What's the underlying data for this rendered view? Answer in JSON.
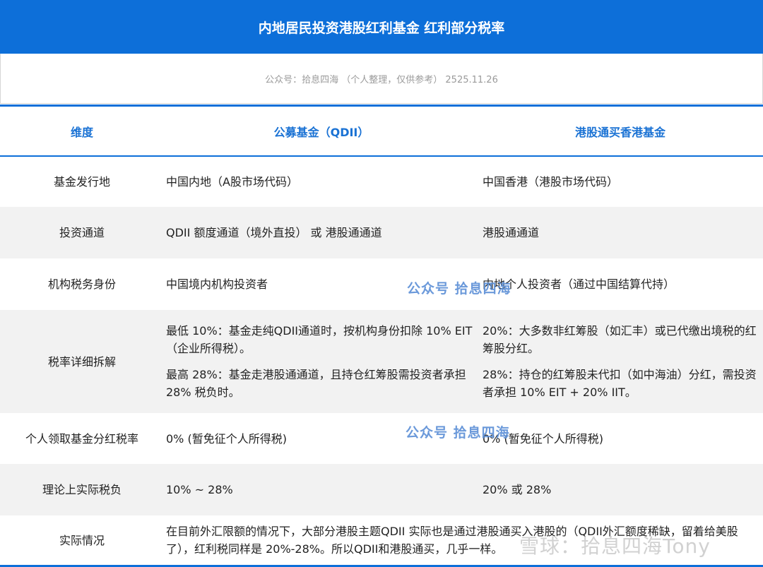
{
  "title": "内地居民投资港股红利基金 红利部分税率",
  "subtitle": "公众号：拾息四海 （个人整理，仅供参考） 2525.11.26",
  "headers": [
    "维度",
    "公募基金（QDII）",
    "港股通买香港基金"
  ],
  "rows": [
    {
      "dim": "基金发行地",
      "qdii": "中国内地（A股市场代码）",
      "hk": "中国香港（港股市场代码）"
    },
    {
      "dim": "投资通道",
      "qdii": "QDII 额度通道（境外直投） 或 港股通通道",
      "hk": "港股通通道"
    },
    {
      "dim": "机构税务身份",
      "qdii": "中国境内机构投资者",
      "hk": "内地个人投资者（通过中国结算代持）"
    },
    {
      "dim": "税率详细拆解",
      "qdii": [
        "最低 10%：基金走纯QDII通道时，按机构身份扣除 10% EIT（企业所得税）。",
        "最高 28%：基金走港股通通道，且持仓红筹股需投资者承担 28% 税负时。"
      ],
      "hk": [
        "20%：大多数非红筹股（如汇丰）或已代缴出境税的红筹股分红。",
        "28%：持仓的红筹股未代扣（如中海油）分红，需投资者承担 10% EIT + 20% IIT。"
      ]
    },
    {
      "dim": "个人领取基金分红税率",
      "qdii": "0% (暂免征个人所得税)",
      "hk": "0% (暂免征个人所得税)"
    },
    {
      "dim": "理论上实际税负",
      "qdii": "10% ~ 28%",
      "hk": "20% 或 28%"
    },
    {
      "dim": "实际情况",
      "wide": "在目前外汇限额的情况下，大部分港股主题QDII 实际也是通过港股通买入港股的（QDII外汇额度稀缺，留着给美股了），红利税同样是 20%-28%。所以QDII和港股通买，几乎一样。"
    }
  ],
  "watermarks": {
    "wm1": "公众号 拾息四海",
    "wm2": "公众号 拾息四海",
    "wm3": "雪球：拾息四海Tony"
  },
  "colors": {
    "accent": "#0d6fd9",
    "header_text": "#1a72d4",
    "row_shade": "#f2f2f2"
  }
}
